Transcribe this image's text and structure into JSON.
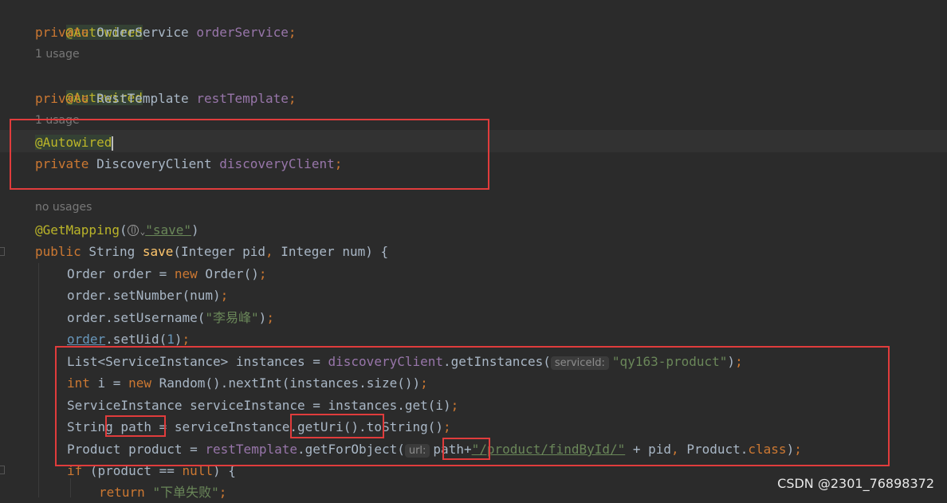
{
  "code": {
    "l1_anno": "@Autowired",
    "l2_kw": "private",
    "l2_type": "OrderService",
    "l2_field": "orderService",
    "l2_semi": ";",
    "l3_hint": "1 usage",
    "l4_anno": "@Autowired",
    "l5_kw": "private",
    "l5_type": "RestTemplate",
    "l5_field": "restTemplate",
    "l5_semi": ";",
    "l6_hint": "1 usage",
    "l7_anno": "@Autowired",
    "l8_kw": "private",
    "l8_type": "DiscoveryClient",
    "l8_field": "discoveryClient",
    "l8_semi": ";",
    "l10_hint": "no usages",
    "l11_anno": "@GetMapping",
    "l11_open": "(",
    "l11_str": "\"save\"",
    "l11_close": ")",
    "l12_kw": "public",
    "l12_rest1": " String ",
    "l12_fn": "save",
    "l12_rest2": "(Integer pid",
    "l12_comma": ",",
    "l12_rest3": " Integer num) {",
    "l13_a": "Order order = ",
    "l13_new": "new",
    "l13_b": " Order()",
    "l13_semi": ";",
    "l14_a": "order.setNumber(num)",
    "l14_semi": ";",
    "l15_a": "order.setUsername(",
    "l15_str": "\"李易峰\"",
    "l15_b": ")",
    "l15_semi": ";",
    "l16_field": "order",
    "l16_a": ".setUid(",
    "l16_num": "1",
    "l16_b": ")",
    "l16_semi": ";",
    "l17_a": "List<ServiceInstance> instances = ",
    "l17_field": "discoveryClient",
    "l17_b": ".getInstances(",
    "l17_hint": "serviceId:",
    "l17_str": "\"qy163-product\"",
    "l17_c": ")",
    "l17_semi": ";",
    "l18_kw": "int",
    "l18_a": " i = ",
    "l18_new": "new",
    "l18_b": " Random().nextInt(instances.size())",
    "l18_semi": ";",
    "l19_a": "ServiceInstance serviceInstance = instances.get(i)",
    "l19_semi": ";",
    "l20_a": "String path = serviceInstance.getUri().toString()",
    "l20_semi": ";",
    "l21_a": "Product product = ",
    "l21_field": "restTemplate",
    "l21_b": ".getForObject(",
    "l21_hint": "url:",
    "l21_c": "path+",
    "l21_str": "\"/product/findById/\"",
    "l21_d": " + pid",
    "l21_comma": ",",
    "l21_e": " Product.",
    "l21_kw": "class",
    "l21_f": ")",
    "l21_semi": ";",
    "l22_kw": "if",
    "l22_a": " (product == ",
    "l22_null": "null",
    "l22_b": ") {",
    "l23_kw": "return",
    "l23_str": "\"下单失败\"",
    "l23_semi": ";"
  },
  "watermark": "CSDN @2301_76898372",
  "colors": {
    "background": "#2b2b2b",
    "keyword": "#cc7832",
    "string": "#6a8759",
    "field": "#9876aa",
    "annotation": "#bbb529",
    "highlight_box": "#e03c3c"
  }
}
